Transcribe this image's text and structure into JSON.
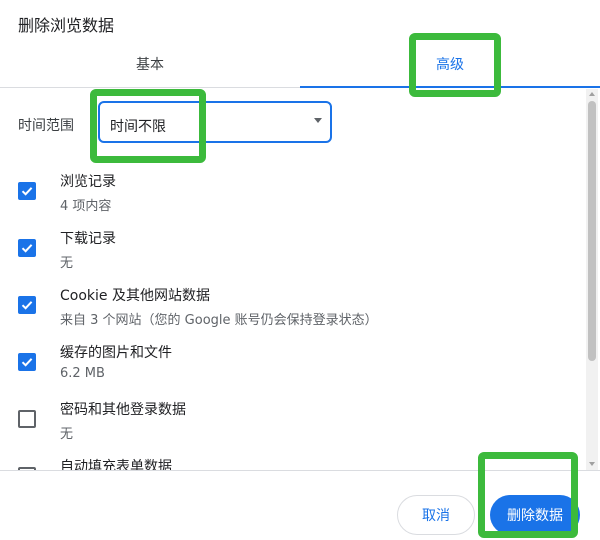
{
  "dialog": {
    "title": "删除浏览数据"
  },
  "tabs": [
    {
      "label": "基本",
      "selected": false
    },
    {
      "label": "高级",
      "selected": true
    }
  ],
  "time_range": {
    "label": "时间范围",
    "value": "时间不限"
  },
  "items": [
    {
      "title": "浏览记录",
      "subtitle": "4 项内容",
      "checked": true
    },
    {
      "title": "下载记录",
      "subtitle": "无",
      "checked": true
    },
    {
      "title": "Cookie 及其他网站数据",
      "subtitle": "来自 3 个网站（您的 Google 账号仍会保持登录状态）",
      "checked": true
    },
    {
      "title": "缓存的图片和文件",
      "subtitle": "6.2 MB",
      "checked": true
    },
    {
      "title": "密码和其他登录数据",
      "subtitle": "无",
      "checked": false
    },
    {
      "title": "自动填充表单数据",
      "subtitle": "",
      "checked": false
    }
  ],
  "buttons": {
    "cancel": "取消",
    "delete": "删除数据"
  },
  "colors": {
    "accent": "#1a73e8",
    "highlight": "#3cba3c"
  }
}
